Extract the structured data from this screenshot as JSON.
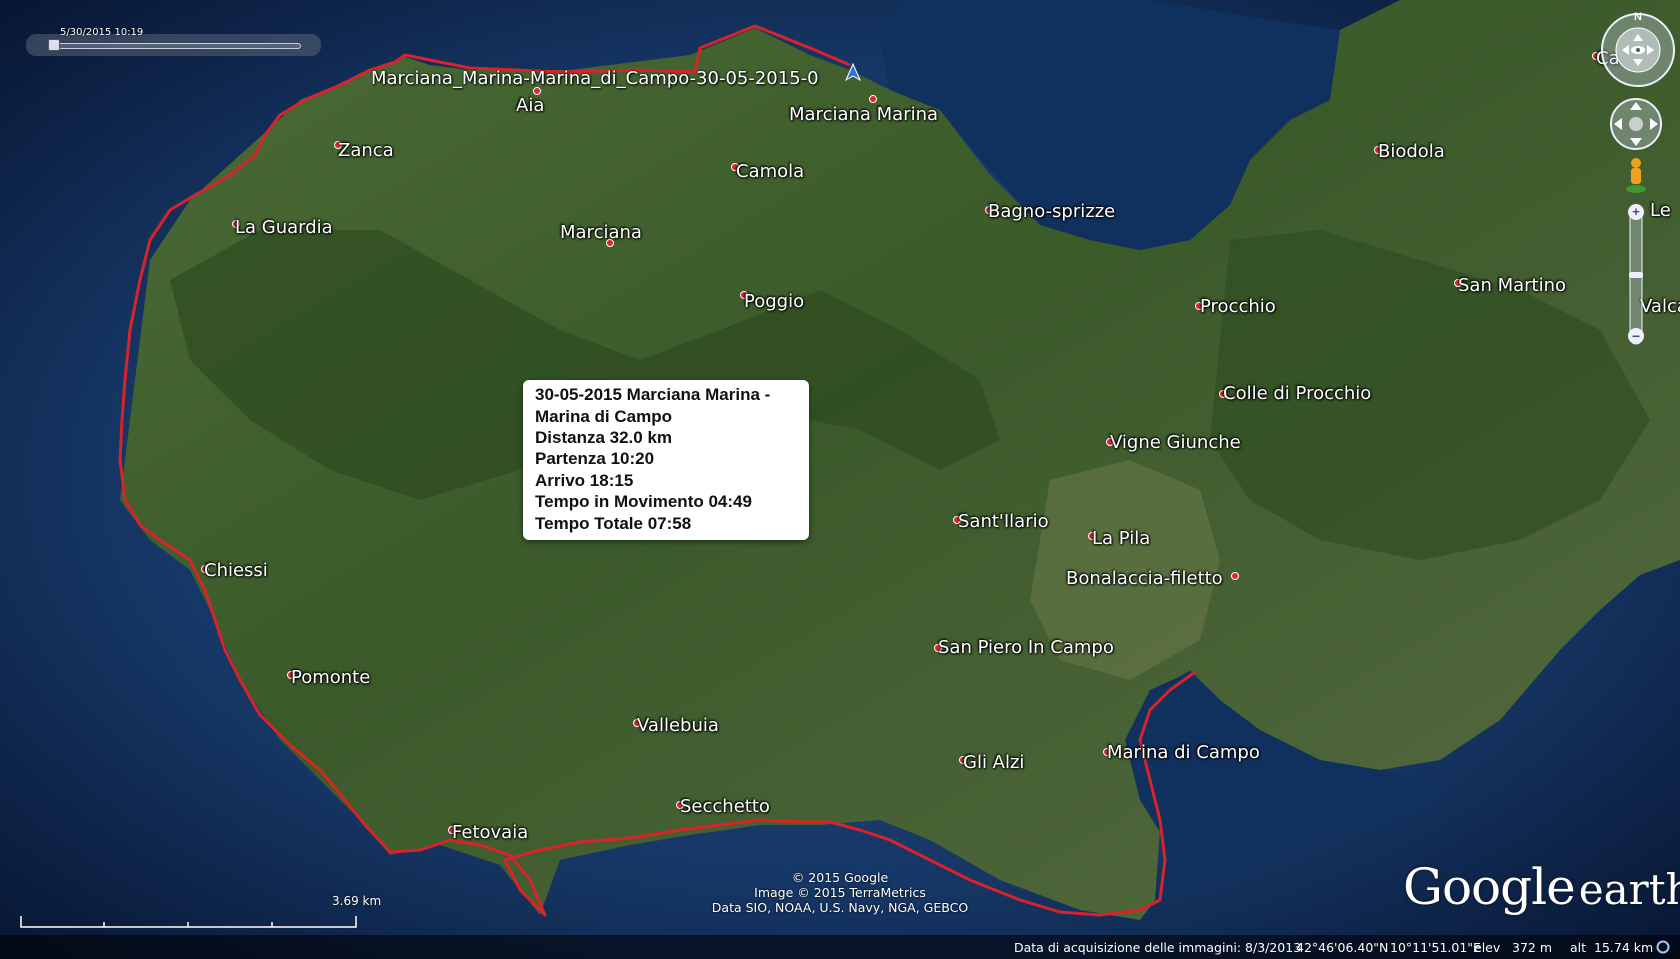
{
  "time_slider": {
    "label": "5/30/2015  10:19"
  },
  "track": {
    "name": "Marciana_Marina-Marina_di_Campo-30-05-2015-0",
    "color": "#d8232a"
  },
  "places": [
    {
      "name": "Aia"
    },
    {
      "name": "Marciana Marina"
    },
    {
      "name": "Zanca"
    },
    {
      "name": "Camola"
    },
    {
      "name": "La Guardia"
    },
    {
      "name": "Marciana"
    },
    {
      "name": "Bagno-sprizze"
    },
    {
      "name": "Biodola"
    },
    {
      "name": "Poggio"
    },
    {
      "name": "Procchio"
    },
    {
      "name": "San Martino"
    },
    {
      "name": "Colle di Procchio"
    },
    {
      "name": "Vigne Giunche"
    },
    {
      "name": "Sant'Ilario"
    },
    {
      "name": "La Pila"
    },
    {
      "name": "Bonalaccia-filetto"
    },
    {
      "name": "Chiessi"
    },
    {
      "name": "San Piero In Campo"
    },
    {
      "name": "Pomonte"
    },
    {
      "name": "Vallebuia"
    },
    {
      "name": "Gli Alzi"
    },
    {
      "name": "Marina di Campo"
    },
    {
      "name": "Secchetto"
    },
    {
      "name": "Fetovaia"
    },
    {
      "name": "Ca"
    },
    {
      "name": "Le"
    },
    {
      "name": "Valca"
    }
  ],
  "popup": {
    "line1": "30-05-2015 Marciana Marina -",
    "line2": "Marina di Campo",
    "line3": "Distanza 32.0 km",
    "line4": "Partenza 10:20",
    "line5": "Arrivo 18:15",
    "line6": "Tempo in Movimento 04:49",
    "line7": "Tempo Totale 07:58"
  },
  "copyright": {
    "line1": "© 2015 Google",
    "line2": "Image © 2015 TerraMetrics",
    "line3": "Data SIO, NOAA, U.S. Navy, NGA, GEBCO"
  },
  "scale": {
    "label": "3.69 km"
  },
  "status_bar": {
    "imagery_date": "Data di acquisizione delle immagini: 8/3/2013",
    "lat": "42°46'06.40\"N",
    "lon": "10°11'51.01\"E",
    "elev_label": "elev",
    "elev": "372 m",
    "alt_label": "alt",
    "alt": "15.74 km"
  },
  "logo": {
    "google": "Google",
    "earth": "earth"
  },
  "compass": {
    "north": "N"
  },
  "colors": {
    "sea": "#0b1d3d",
    "land": "#3e5a2c",
    "track": "#d8232a",
    "place_dot": "#e02430"
  }
}
